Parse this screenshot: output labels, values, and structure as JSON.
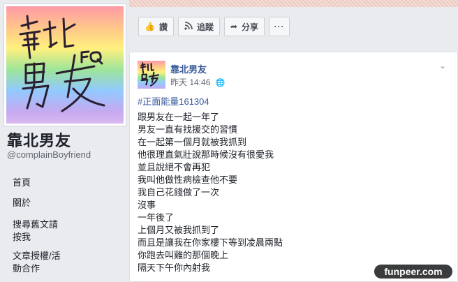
{
  "page": {
    "name": "靠北男友",
    "handle": "@complainBoyfriend",
    "logo_text": {
      "main": "靠北",
      "sub": "FQ",
      "second": "男友"
    }
  },
  "nav": [
    {
      "label": "首頁"
    },
    {
      "label": "關於"
    },
    {
      "label": "搜尋舊文請按我"
    },
    {
      "label": "文章授權/活動合作"
    }
  ],
  "actions": {
    "like": {
      "label": "讚",
      "icon": "thumbs-up-icon"
    },
    "follow": {
      "label": "追蹤",
      "icon": "rss-icon"
    },
    "share": {
      "label": "分享",
      "icon": "share-arrow-icon"
    },
    "more": {
      "label": "···",
      "icon": "more-icon"
    }
  },
  "post": {
    "author": "靠北男友",
    "time": "昨天 14:46",
    "privacy_icon": "globe-icon",
    "hashtag": "#正面能量161304",
    "lines": [
      "跟男友在一起一年了",
      "男友一直有找援交的習慣",
      "在一起第一個月就被我抓到",
      "他很理直氣壯說那時候沒有很愛我",
      "並且說絕不會再犯",
      "我叫他做性病檢查他不要",
      "我自己花錢做了一次",
      "沒事",
      "一年後了",
      "上個月又被我抓到了",
      "而且是讓我在你家樓下等到凌晨兩點",
      "你跑去叫雞的那個晚上",
      "隔天下午你內射我"
    ]
  },
  "watermark": "funpeer.com",
  "colors": {
    "link": "#365899",
    "text": "#1d2129",
    "background": "#e9ebee"
  }
}
